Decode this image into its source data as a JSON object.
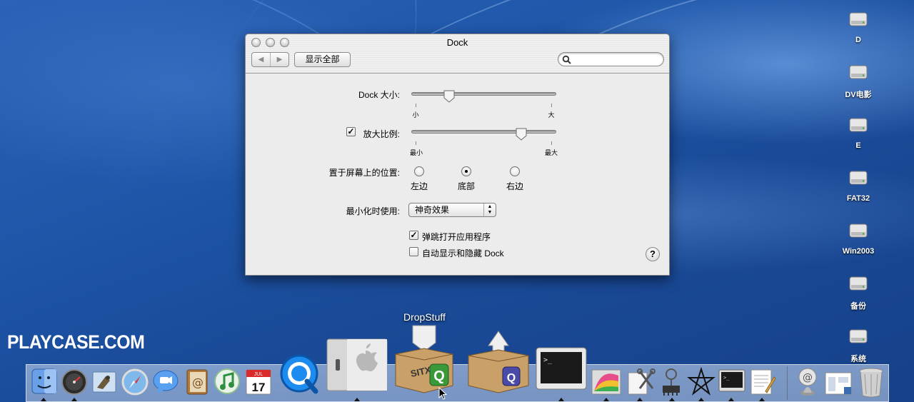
{
  "desktop": {
    "drives": [
      {
        "label": "D",
        "icon": "hard-drive-icon"
      },
      {
        "label": "DV电影",
        "icon": "hard-drive-icon"
      },
      {
        "label": "E",
        "icon": "hard-drive-icon"
      },
      {
        "label": "FAT32",
        "icon": "hard-drive-icon"
      },
      {
        "label": "Win2003",
        "icon": "hard-drive-icon"
      },
      {
        "label": "备份",
        "icon": "hard-drive-icon"
      },
      {
        "label": "系统",
        "icon": "hard-drive-icon"
      }
    ],
    "watermark": "PLAYCASE.COM"
  },
  "window": {
    "title": "Dock",
    "nav_back": "◀",
    "nav_forward": "▶",
    "show_all": "显示全部",
    "search_placeholder": "",
    "dock_size": {
      "label": "Dock 大小:",
      "min_label": "小",
      "max_label": "大",
      "value": 0.26
    },
    "magnification": {
      "label": "放大比例:",
      "checked": true,
      "min_label": "最小",
      "max_label": "最大",
      "value": 0.76
    },
    "position": {
      "label": "置于屏幕上的位置:",
      "options": [
        "左边",
        "底部",
        "右边"
      ],
      "selected": "底部"
    },
    "minimize": {
      "label": "最小化时使用:",
      "value": "神奇效果"
    },
    "animate": {
      "label": "弹跳打开应用程序",
      "checked": true
    },
    "autohide": {
      "label": "自动显示和隐藏 Dock",
      "checked": false
    },
    "help": "?"
  },
  "dock": {
    "hover_label": "DropStuff",
    "items": [
      "finder-icon",
      "dashboard-icon",
      "mail-icon",
      "safari-icon",
      "ichat-icon",
      "address-book-icon",
      "itunes-icon",
      "ical-icon",
      "quicktime-icon",
      "system-preferences-icon",
      "dropstuff-icon",
      "dropzip-icon",
      "terminal-icon",
      "grapher-icon",
      "utility-icon",
      "system-profiler-icon",
      "pentagram-icon",
      "console-icon",
      "textedit-icon",
      "url-icon",
      "document-icon",
      "trash-icon"
    ],
    "ical_day": "17",
    "ical_month": "JUL"
  },
  "colors": {
    "desktop": "#1e56a8",
    "window_bg": "#ececec",
    "dock_bg": "#c8d6ea"
  }
}
